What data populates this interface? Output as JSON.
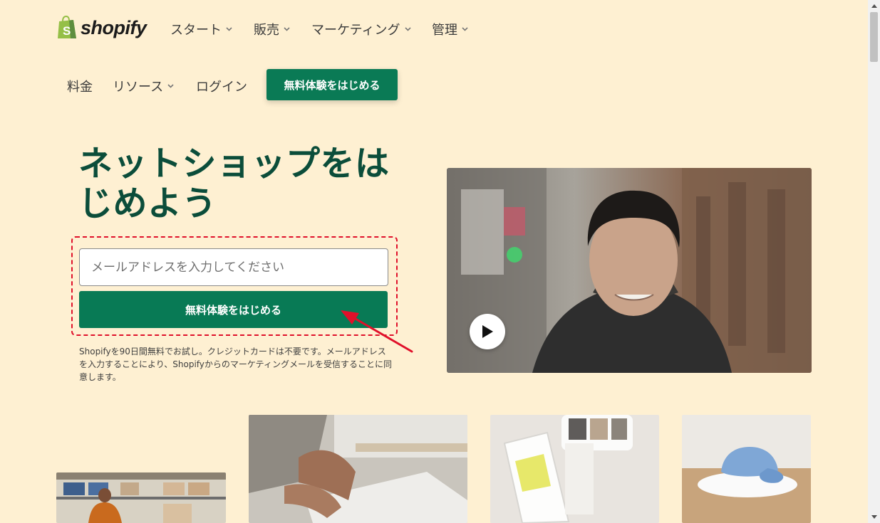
{
  "brand": {
    "name": "shopify",
    "color": "#95bf47"
  },
  "nav_primary": [
    {
      "label": "スタート",
      "has_dropdown": true
    },
    {
      "label": "販売",
      "has_dropdown": true
    },
    {
      "label": "マーケティング",
      "has_dropdown": true
    },
    {
      "label": "管理",
      "has_dropdown": true
    }
  ],
  "nav_secondary": [
    {
      "label": "料金",
      "has_dropdown": false
    },
    {
      "label": "リソース",
      "has_dropdown": true
    },
    {
      "label": "ログイン",
      "has_dropdown": false
    }
  ],
  "header_cta": {
    "label": "無料体験をはじめる"
  },
  "hero": {
    "title": "ネットショップをはじめよう",
    "email_placeholder": "メールアドレスを入力してください",
    "email_value": "",
    "cta_label": "無料体験をはじめる",
    "disclaimer": "Shopifyを90日間無料でお試し。クレジットカードは不要です。メールアドレスを入力することにより、Shopifyからのマーケティングメールを受信することに同意します。"
  },
  "video": {
    "play_icon": "play-icon"
  },
  "colors": {
    "background": "#fef0d2",
    "primary_green": "#087a55",
    "title_green": "#0b4d3a",
    "annotation_red": "#e0102a"
  }
}
